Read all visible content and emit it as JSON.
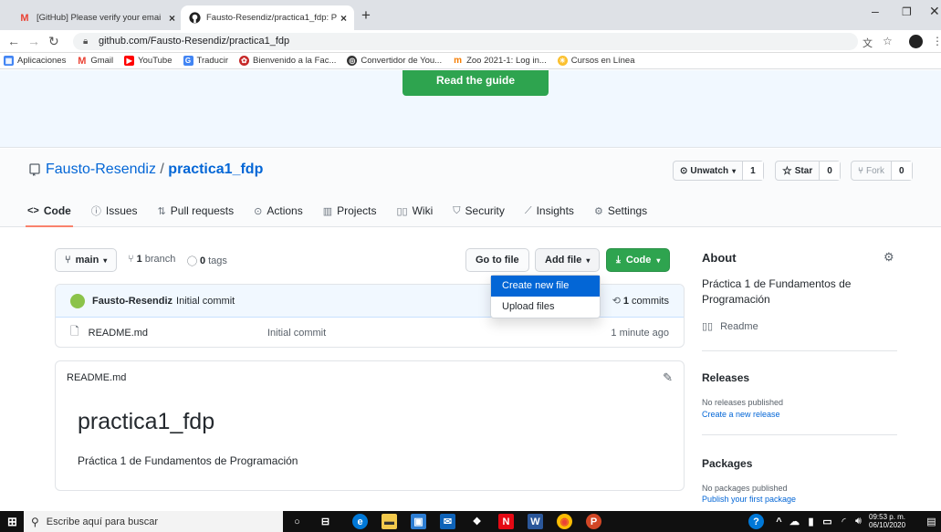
{
  "browser": {
    "tabs": [
      {
        "label": "[GitHub] Please verify your emai",
        "icon": "gmail-icon"
      },
      {
        "label": "Fausto-Resendiz/practica1_fdp: P",
        "icon": "github-icon"
      }
    ],
    "url": "github.com/Fausto-Resendiz/practica1_fdp",
    "bookmarks": [
      {
        "label": "Aplicaciones",
        "color": "#4285f4"
      },
      {
        "label": "Gmail",
        "color": "#ea4335"
      },
      {
        "label": "YouTube",
        "color": "#ff0000"
      },
      {
        "label": "Traducir",
        "color": "#4285f4"
      },
      {
        "label": "Bienvenido a la Fac...",
        "color": "#c62828"
      },
      {
        "label": "Convertidor de You...",
        "color": "#333333"
      },
      {
        "label": "Zoo 2021-1: Log in...",
        "color": "#f57c00"
      },
      {
        "label": "Cursos en Línea",
        "color": "#fbc02d"
      }
    ]
  },
  "banner": {
    "guide_button": "Read the guide"
  },
  "repo": {
    "owner": "Fausto-Resendiz",
    "separator": " / ",
    "name": "practica1_fdp",
    "unwatch_label": "Unwatch",
    "unwatch_count": "1",
    "star_label": "Star",
    "star_count": "0",
    "fork_label": "Fork",
    "fork_count": "0",
    "tabs": [
      "Code",
      "Issues",
      "Pull requests",
      "Actions",
      "Projects",
      "Wiki",
      "Security",
      "Insights",
      "Settings"
    ]
  },
  "file_nav": {
    "branch": "main",
    "branches_count": "1",
    "branches_label": "branch",
    "tags_count": "0",
    "tags_label": "tags",
    "go_to_file": "Go to file",
    "add_file": "Add file",
    "code": "Code"
  },
  "dropdown": {
    "items": [
      "Create new file",
      "Upload files"
    ]
  },
  "commit": {
    "author": "Fausto-Resendiz",
    "message": "Initial commit",
    "count": "1",
    "count_label": "commits"
  },
  "files": [
    {
      "name": "README.md",
      "message": "Initial commit",
      "time": "1 minute ago"
    }
  ],
  "readme": {
    "file_label": "README.md",
    "heading": "practica1_fdp",
    "body": "Práctica 1 de Fundamentos de Programación"
  },
  "sidebar": {
    "about_title": "About",
    "description": "Práctica 1 de Fundamentos de Programación",
    "readme_link": "Readme",
    "releases_title": "Releases",
    "releases_none": "No releases published",
    "releases_create": "Create a new release",
    "packages_title": "Packages",
    "packages_none": "No packages published",
    "packages_publish": "Publish your first package"
  },
  "taskbar": {
    "search_placeholder": "Escribe aquí para buscar",
    "time": "09:53 p. m.",
    "date": "06/10/2020"
  }
}
